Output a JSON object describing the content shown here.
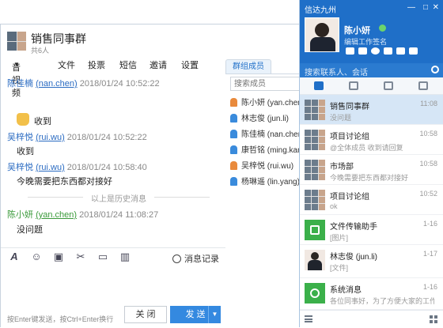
{
  "chat": {
    "title": "销售同事群",
    "subtitle": "共6人",
    "menu": [
      "音视频",
      "文件",
      "投票",
      "短信",
      "邀请",
      "设置"
    ],
    "messages": [
      {
        "name": "陈佳楠",
        "uid": "(nan.chen)",
        "time": "2018/01/24 10:52:22",
        "text": "收到",
        "sticker": "wave-hand"
      },
      {
        "name": "吴梓悦",
        "uid": "(rui.wu)",
        "time": "2018/01/24 10:52:22",
        "text": "收到"
      },
      {
        "name": "吴梓悦",
        "uid": "(rui.wu)",
        "time": "2018/01/24 10:58:40",
        "text": "今晚需要把东西都对接好"
      },
      {
        "name": "陈小妍",
        "uid": "(yan.chen)",
        "time": "2018/01/24 11:08:27",
        "text": "没问题"
      }
    ],
    "history_label": "以上是历史消息",
    "toolbar_icons": [
      "font-icon",
      "emoji-icon",
      "image-icon",
      "scissors-icon",
      "folder-icon",
      "chart-icon"
    ],
    "history_button": "消息记录",
    "hint": "按Enter键发送，按Ctrl+Enter换行",
    "close_label": "关 闭",
    "send_label": "发 送"
  },
  "members": {
    "tab_label": "群组成员",
    "search_placeholder": "搜索成员",
    "list": [
      {
        "name": "陈小妍 (yan.chen)",
        "color": "#e98a3c"
      },
      {
        "name": "林志俊 (jun.li)",
        "color": "#3a8bdc"
      },
      {
        "name": "陈佳楠 (nan.chen)",
        "color": "#3a8bdc"
      },
      {
        "name": "康哲铭 (ming.kang)",
        "color": "#3a8bdc"
      },
      {
        "name": "吴梓悦 (rui.wu)",
        "color": "#e98a3c"
      },
      {
        "name": "杨琳遥 (lin.yang)",
        "color": "#3a8bdc"
      }
    ]
  },
  "side": {
    "app_name": "信达九州",
    "me": {
      "name": "陈小妍",
      "signature": "编辑工作签名"
    },
    "search_placeholder": "搜索联系人、会话",
    "conversations": [
      {
        "name": "销售同事群",
        "preview": "没问题",
        "time": "11:08",
        "avatar": "group",
        "selected": true
      },
      {
        "name": "项目讨论组",
        "preview": "@全体成员 收到请回复",
        "time": "10:58",
        "avatar": "group"
      },
      {
        "name": "市场部",
        "preview": "今晚需要把东西都对接好",
        "time": "10:58",
        "avatar": "group"
      },
      {
        "name": "项目讨论组",
        "preview": "ok",
        "time": "10:52",
        "avatar": "group"
      },
      {
        "name": "文件传输助手",
        "preview": "[图片]",
        "time": "1-16",
        "avatar": "green"
      },
      {
        "name": "林志俊 (jun.li)",
        "preview": "[文件]",
        "time": "1-17",
        "avatar": "single"
      },
      {
        "name": "系统消息",
        "preview": "各位同事好，为了方便大家的工作效...",
        "time": "1-16",
        "avatar": "green"
      }
    ]
  }
}
